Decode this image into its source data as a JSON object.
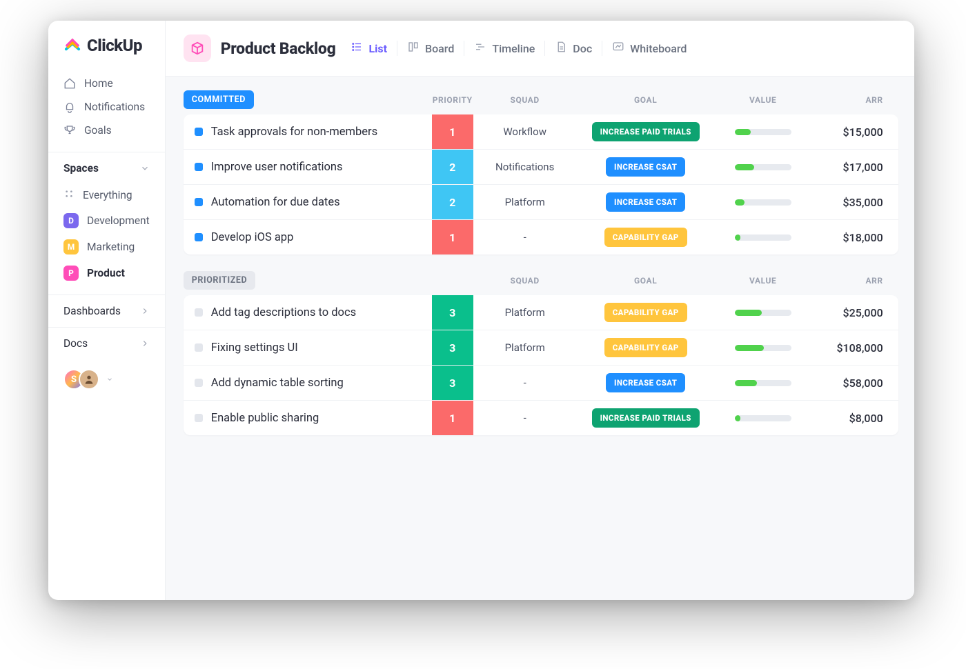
{
  "brand": "ClickUp",
  "sidebar": {
    "nav": [
      {
        "label": "Home"
      },
      {
        "label": "Notifications"
      },
      {
        "label": "Goals"
      }
    ],
    "spaces_header": "Spaces",
    "spaces": [
      {
        "label": "Everything",
        "badge": "",
        "type": "everything"
      },
      {
        "label": "Development",
        "badge": "D",
        "type": "dev"
      },
      {
        "label": "Marketing",
        "badge": "M",
        "type": "mkt"
      },
      {
        "label": "Product",
        "badge": "P",
        "type": "prd",
        "active": true
      }
    ],
    "dashboards": "Dashboards",
    "docs": "Docs",
    "avatar_initial": "S"
  },
  "header": {
    "title": "Product Backlog",
    "views": [
      {
        "label": "List",
        "active": true
      },
      {
        "label": "Board"
      },
      {
        "label": "Timeline"
      },
      {
        "label": "Doc"
      },
      {
        "label": "Whiteboard"
      }
    ]
  },
  "columns": {
    "priority": "PRIORITY",
    "squad": "SQUAD",
    "goal": "GOAL",
    "value": "VALUE",
    "arr": "ARR"
  },
  "groups": [
    {
      "name": "COMMITTED",
      "pill": "pill-blue",
      "sq": "sq-blue",
      "show_priority_header": true,
      "rows": [
        {
          "task": "Task approvals for non-members",
          "priority": "1",
          "pclass": "p1",
          "squad": "Workflow",
          "goal": "INCREASE PAID TRIALS",
          "gclass": "g-green",
          "value_pct": 28,
          "arr": "$15,000"
        },
        {
          "task": "Improve  user notifications",
          "priority": "2",
          "pclass": "p2",
          "squad": "Notifications",
          "goal": "INCREASE CSAT",
          "gclass": "g-blue",
          "value_pct": 34,
          "arr": "$17,000"
        },
        {
          "task": "Automation for due dates",
          "priority": "2",
          "pclass": "p2",
          "squad": "Platform",
          "goal": "INCREASE CSAT",
          "gclass": "g-blue",
          "value_pct": 18,
          "arr": "$35,000"
        },
        {
          "task": "Develop iOS app",
          "priority": "1",
          "pclass": "p1",
          "squad": "-",
          "goal": "CAPABILITY GAP",
          "gclass": "g-yellow",
          "value_pct": 10,
          "arr": "$18,000"
        }
      ]
    },
    {
      "name": "PRIORITIZED",
      "pill": "pill-grey",
      "sq": "sq-grey",
      "show_priority_header": false,
      "rows": [
        {
          "task": "Add tag descriptions to docs",
          "priority": "3",
          "pclass": "p3",
          "squad": "Platform",
          "goal": "CAPABILITY GAP",
          "gclass": "g-yellow",
          "value_pct": 48,
          "arr": "$25,000"
        },
        {
          "task": "Fixing settings UI",
          "priority": "3",
          "pclass": "p3",
          "squad": "Platform",
          "goal": "CAPABILITY GAP",
          "gclass": "g-yellow",
          "value_pct": 52,
          "arr": "$108,000"
        },
        {
          "task": "Add dynamic table sorting",
          "priority": "3",
          "pclass": "p3",
          "squad": "-",
          "goal": "INCREASE CSAT",
          "gclass": "g-blue",
          "value_pct": 40,
          "arr": "$58,000"
        },
        {
          "task": "Enable public sharing",
          "priority": "1",
          "pclass": "p1",
          "squad": "-",
          "goal": "INCREASE PAID TRIALS",
          "gclass": "g-green",
          "value_pct": 10,
          "arr": "$8,000"
        }
      ]
    }
  ]
}
